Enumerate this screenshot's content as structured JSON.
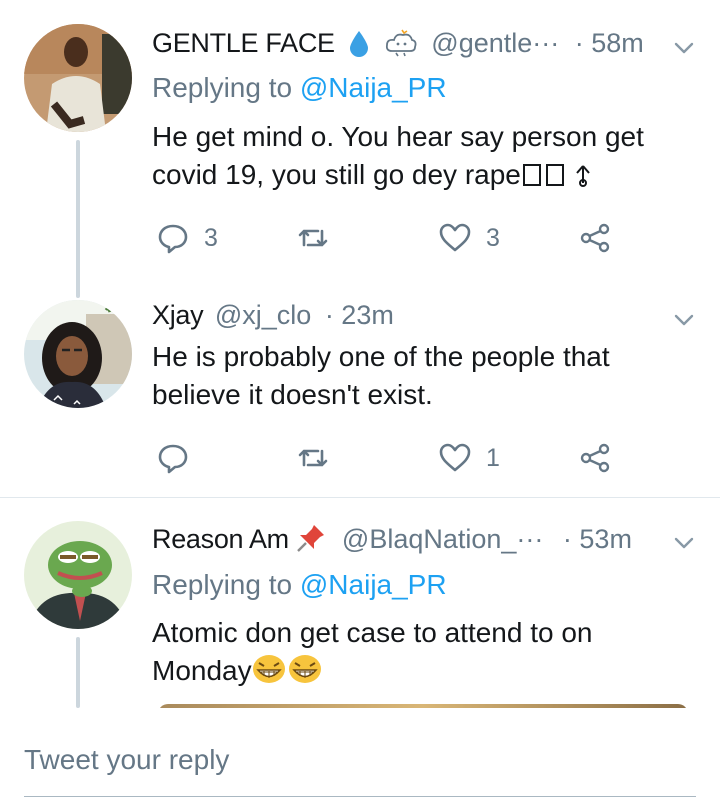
{
  "tweets": [
    {
      "name": "GENTLE FACE",
      "handle": "@gentle···",
      "time": "· 58m",
      "replying_label": "Replying to",
      "replying_mention": "@Naija_PR",
      "text_line1": "He get mind o. You hear say person get",
      "text_line2": "covid 19, you still go dey rape",
      "reply_count": "3",
      "retweet_count": "",
      "like_count": "3"
    },
    {
      "name": "Xjay",
      "handle": "@xj_clo",
      "time": "· 23m",
      "text_line1": "He is probably one of the people that",
      "text_line2": "believe it doesn't exist.",
      "reply_count": "",
      "retweet_count": "",
      "like_count": "1"
    },
    {
      "name": "Reason Am",
      "handle": "@BlaqNation_···",
      "time": "· 53m",
      "replying_label": "Replying to",
      "replying_mention": "@Naija_PR",
      "text_line1": "Atomic don get case to attend to on",
      "text_line2": "Monday"
    }
  ],
  "composer": {
    "placeholder": "Tweet your reply"
  },
  "colors": {
    "accent": "#1da1f2",
    "secondary_text": "#657786",
    "thread_line": "#ccd6dd"
  }
}
